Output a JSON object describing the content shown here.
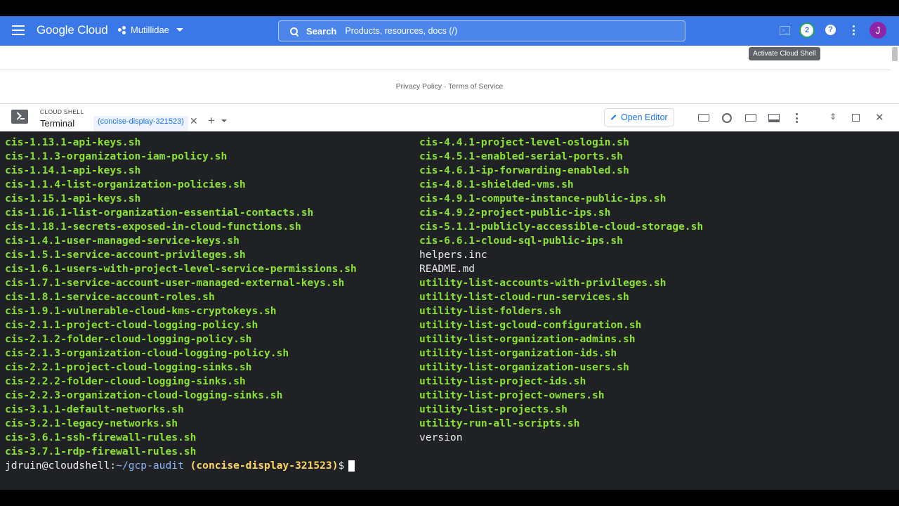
{
  "header": {
    "logo": "Google Cloud",
    "project": "Mutillidae",
    "search_label": "Search",
    "search_placeholder": "Products, resources, docs (/)",
    "notifications_count": "2",
    "help": "?",
    "avatar_initial": "J"
  },
  "tooltip": "Activate Cloud Shell",
  "footer": {
    "links": "Privacy Policy · Terms of Service"
  },
  "shell": {
    "title": "CLOUD SHELL",
    "subtitle": "Terminal",
    "tab_label": "(concise-display-321523)",
    "open_editor_label": "Open Editor"
  },
  "terminal": {
    "left_column": [
      {
        "text": "cis-1.13.1-api-keys.sh",
        "type": "green"
      },
      {
        "text": "cis-1.1.3-organization-iam-policy.sh",
        "type": "green"
      },
      {
        "text": "cis-1.14.1-api-keys.sh",
        "type": "green"
      },
      {
        "text": "cis-1.1.4-list-organization-policies.sh",
        "type": "green"
      },
      {
        "text": "cis-1.15.1-api-keys.sh",
        "type": "green"
      },
      {
        "text": "cis-1.16.1-list-organization-essential-contacts.sh",
        "type": "green"
      },
      {
        "text": "cis-1.18.1-secrets-exposed-in-cloud-functions.sh",
        "type": "green"
      },
      {
        "text": "cis-1.4.1-user-managed-service-keys.sh",
        "type": "green"
      },
      {
        "text": "cis-1.5.1-service-account-privileges.sh",
        "type": "green"
      },
      {
        "text": "cis-1.6.1-users-with-project-level-service-permissions.sh",
        "type": "green"
      },
      {
        "text": "cis-1.7.1-service-account-user-managed-external-keys.sh",
        "type": "green"
      },
      {
        "text": "cis-1.8.1-service-account-roles.sh",
        "type": "green"
      },
      {
        "text": "cis-1.9.1-vulnerable-cloud-kms-cryptokeys.sh",
        "type": "green"
      },
      {
        "text": "cis-2.1.1-project-cloud-logging-policy.sh",
        "type": "green"
      },
      {
        "text": "cis-2.1.2-folder-cloud-logging-policy.sh",
        "type": "green"
      },
      {
        "text": "cis-2.1.3-organization-cloud-logging-policy.sh",
        "type": "green"
      },
      {
        "text": "cis-2.2.1-project-cloud-logging-sinks.sh",
        "type": "green"
      },
      {
        "text": "cis-2.2.2-folder-cloud-logging-sinks.sh",
        "type": "green"
      },
      {
        "text": "cis-2.2.3-organization-cloud-logging-sinks.sh",
        "type": "green"
      },
      {
        "text": "cis-3.1.1-default-networks.sh",
        "type": "green"
      },
      {
        "text": "cis-3.2.1-legacy-networks.sh",
        "type": "green"
      },
      {
        "text": "cis-3.6.1-ssh-firewall-rules.sh",
        "type": "green"
      },
      {
        "text": "cis-3.7.1-rdp-firewall-rules.sh",
        "type": "green"
      }
    ],
    "right_column": [
      {
        "text": "cis-4.4.1-project-level-oslogin.sh",
        "type": "green"
      },
      {
        "text": "cis-4.5.1-enabled-serial-ports.sh",
        "type": "green"
      },
      {
        "text": "cis-4.6.1-ip-forwarding-enabled.sh",
        "type": "green"
      },
      {
        "text": "cis-4.8.1-shielded-vms.sh",
        "type": "green"
      },
      {
        "text": "cis-4.9.1-compute-instance-public-ips.sh",
        "type": "green"
      },
      {
        "text": "cis-4.9.2-project-public-ips.sh",
        "type": "green"
      },
      {
        "text": "cis-5.1.1-publicly-accessible-cloud-storage.sh",
        "type": "green"
      },
      {
        "text": "cis-6.6.1-cloud-sql-public-ips.sh",
        "type": "green"
      },
      {
        "text": "helpers.inc",
        "type": "white"
      },
      {
        "text": "README.md",
        "type": "white"
      },
      {
        "text": "utility-list-accounts-with-privileges.sh",
        "type": "green"
      },
      {
        "text": "utility-list-cloud-run-services.sh",
        "type": "green"
      },
      {
        "text": "utility-list-folders.sh",
        "type": "green"
      },
      {
        "text": "utility-list-gcloud-configuration.sh",
        "type": "green"
      },
      {
        "text": "utility-list-organization-admins.sh",
        "type": "green"
      },
      {
        "text": "utility-list-organization-ids.sh",
        "type": "green"
      },
      {
        "text": "utility-list-organization-users.sh",
        "type": "green"
      },
      {
        "text": "utility-list-project-ids.sh",
        "type": "green"
      },
      {
        "text": "utility-list-project-owners.sh",
        "type": "green"
      },
      {
        "text": "utility-list-projects.sh",
        "type": "green"
      },
      {
        "text": "utility-run-all-scripts.sh",
        "type": "green"
      },
      {
        "text": "version",
        "type": "white"
      }
    ],
    "prompt": {
      "user_host": "jdruin@cloudshell:",
      "path": "~/gcp-audit",
      "project": "(concise-display-321523)",
      "symbol": "$"
    }
  },
  "colors": {
    "header_bg": "#3b78e7",
    "terminal_bg": "#202124",
    "exec_green": "#8ae234",
    "accent_blue": "#1a73e8"
  }
}
